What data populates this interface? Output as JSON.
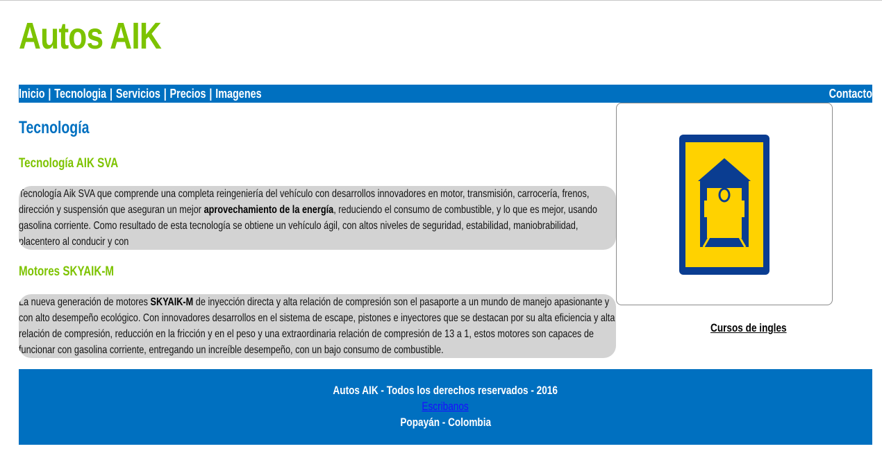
{
  "site": {
    "title": "Autos AIK"
  },
  "nav": {
    "items": [
      {
        "label": "Inicio"
      },
      {
        "label": "Tecnologia"
      },
      {
        "label": "Servicios"
      },
      {
        "label": "Precios"
      },
      {
        "label": "Imagenes"
      }
    ],
    "separator": "|",
    "contact_label": "Contacto"
  },
  "main": {
    "section_title": "Tecnología",
    "sections": [
      {
        "title": "Tecnología AIK SVA",
        "text_before": "Tecnología Aik SVA que comprende una completa reingeniería del vehículo con desarrollos innovadores en motor, transmisión, carrocería, frenos, dirección y suspensión que aseguran un mejor ",
        "text_bold": "aprovechamiento de la energía",
        "text_after": ", reduciendo el consumo de combustible, y lo que es mejor, usando gasolina corriente. Como resultado de esta tecnología se obtiene un vehículo ágil, con altos niveles de seguridad, estabilidad, maniobrabilidad, placentero al conducir y con"
      },
      {
        "title": "Motores SKYAIK-M",
        "text_before": "La nueva generación de motores ",
        "text_bold": "SKYAIK-M",
        "text_after": " de inyección directa y alta relación de compresión son el pasaporte a un mundo de manejo apasionante y con alto desempeño ecológico. Con innovadores desarrollos en el sistema de escape, pistones e inyectores que se destacan por su alta eficiencia y alta relación de compresión, reducción en la fricción y en el peso y una extraordinaria relación de compresión de 13 a 1, estos motores son capaces de funcionar con gasolina corriente, entregando un increíble desempeño, con un bajo consumo de combustible."
      }
    ]
  },
  "aside": {
    "image_icon": "transit-station-sign-icon",
    "link_label": "Cursos de ingles"
  },
  "footer": {
    "copyright": "Autos AIK - Todos los derechos reservados - 2016",
    "contact_link": "Escribanos",
    "location": "Popayán - Colombia"
  },
  "colors": {
    "brand_green": "#7dc300",
    "brand_blue": "#0070c0",
    "paragraph_bg": "#d3d3d3",
    "sign_yellow": "#ffd200",
    "sign_navy": "#0a3d91",
    "footer_link": "#1a0dff"
  }
}
